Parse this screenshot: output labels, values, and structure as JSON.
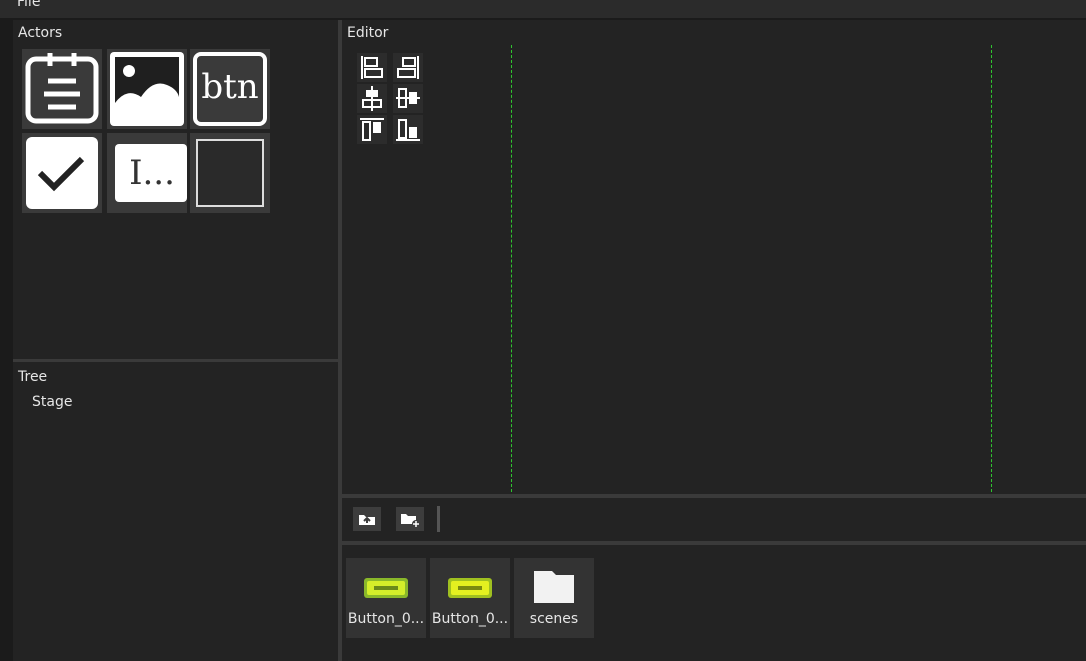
{
  "menu": {
    "file": "File"
  },
  "actors": {
    "title": "Actors",
    "items": [
      {
        "icon": "calendar-list-icon"
      },
      {
        "icon": "image-icon"
      },
      {
        "icon": "button-icon",
        "text": "btn"
      },
      {
        "icon": "checkbox-icon"
      },
      {
        "icon": "text-field-icon",
        "text": "I..."
      },
      {
        "icon": "empty-container-icon"
      }
    ]
  },
  "tree": {
    "title": "Tree",
    "root": "Stage"
  },
  "editor": {
    "title": "Editor",
    "align_tools": [
      "align-left-icon",
      "align-right-icon",
      "align-center-horizontal-icon",
      "align-center-vertical-icon",
      "align-top-icon",
      "align-bottom-icon"
    ],
    "guide_color": "#2fc52f"
  },
  "toolbar": {
    "buttons": [
      "folder-up-icon",
      "new-folder-icon"
    ]
  },
  "assets": {
    "items": [
      {
        "label": "Button_0...",
        "icon": "button-asset-icon"
      },
      {
        "label": "Button_0...",
        "icon": "button-asset-icon"
      },
      {
        "label": "scenes",
        "icon": "folder-icon"
      }
    ]
  }
}
